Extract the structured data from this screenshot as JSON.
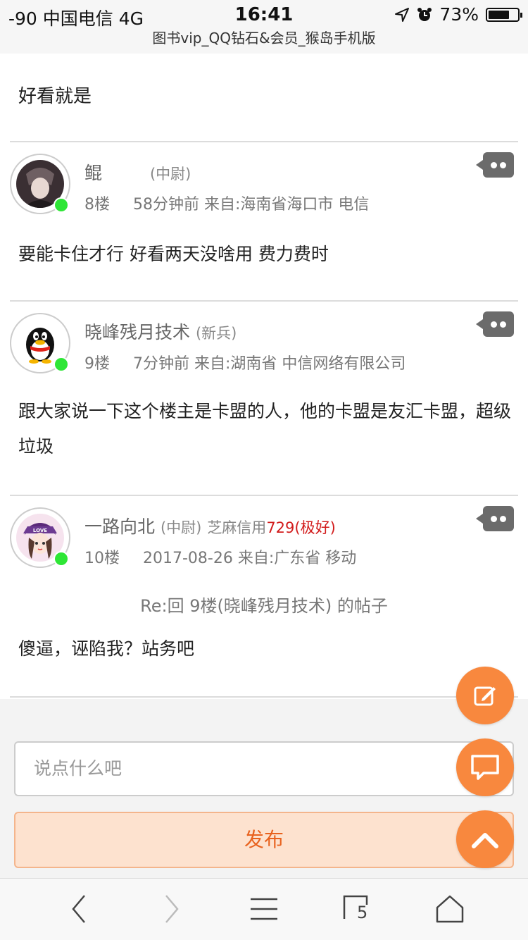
{
  "status_bar": {
    "carrier": "-90 中国电信   4G",
    "time": "16:41",
    "battery_percent": "73%",
    "battery_level": 0.73
  },
  "browser": {
    "page_title": "图书vip_QQ钻石&会员_猴岛手机版",
    "tabs_count": "5"
  },
  "previous_post": {
    "text": "好看就是"
  },
  "posts": [
    {
      "username": "鲲",
      "rank": "(中尉)",
      "floor": "8楼",
      "meta": "58分钟前 来自:海南省海口市 电信",
      "text": "要能卡住才行 好看两天没啥用 费力费时"
    },
    {
      "username": "晓峰残月技术",
      "rank": "(新兵)",
      "floor": "9楼",
      "meta": "7分钟前 来自:湖南省 中信网络有限公司",
      "text": "跟大家说一下这个楼主是卡盟的人，他的卡盟是友汇卡盟，超级垃圾"
    },
    {
      "username": "一路向北",
      "rank": "(中尉)",
      "credit_label": "芝麻信用",
      "credit_value": "729(极好)",
      "floor": "10楼",
      "meta": "2017-08-26 来自:广东省 移动",
      "quote": "Re:回 9楼(晓峰残月技术) 的帖子",
      "text": "傻逼，诬陷我？站务吧"
    }
  ],
  "compose": {
    "placeholder": "说点什么吧",
    "publish_label": "发布"
  },
  "colors": {
    "accent": "#f8883e",
    "online": "#2ee636",
    "credit_red": "#d21c1c"
  },
  "icons": {
    "reply": "reply-bubble-icon",
    "edit": "edit-icon",
    "comment": "comment-icon",
    "top": "chevron-up-icon",
    "back": "back-icon",
    "forward": "forward-icon",
    "menu": "menu-icon",
    "tabs": "tabs-icon",
    "home": "home-icon"
  }
}
